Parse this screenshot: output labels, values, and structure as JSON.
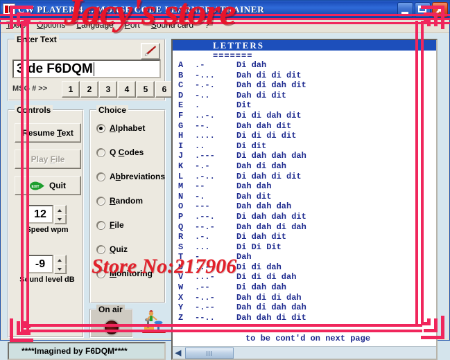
{
  "window": {
    "title": "CW PLAYER 4 ... MORSE CODE LEARNER / TRAINER",
    "icon": "cw-player-icon",
    "buttons": {
      "minimize": "minimize-button",
      "maximize": "maximize-button",
      "close": "close-button"
    }
  },
  "menu": [
    {
      "label": "Tools",
      "accel": "T"
    },
    {
      "label": "Options",
      "accel": "O"
    },
    {
      "label": "Language",
      "accel": "L"
    },
    {
      "label": "Port",
      "accel": "P"
    },
    {
      "label": "Sound card",
      "accel": "S"
    },
    {
      "label": "?",
      "accel": ""
    }
  ],
  "enter_text": {
    "legend": "Enter Text",
    "eraser_icon": "eraser-icon",
    "input_value": "3 de F6DQM",
    "input_placeholder": "",
    "msg_label": "MSG # >>",
    "msg_buttons": [
      "1",
      "2",
      "3",
      "4",
      "5",
      "6"
    ]
  },
  "controls": {
    "legend": "Controls",
    "resume_label": "Resume Text",
    "resume_accel": "T",
    "playfile_label": "Play File",
    "playfile_accel": "F",
    "playfile_enabled": false,
    "quit_label": "Quit",
    "quit_icon": "exit-door-icon",
    "speed_value": "12",
    "speed_label": "Speed   wpm",
    "level_value": "-9",
    "level_label": "Sound level dB"
  },
  "choice": {
    "legend": "Choice",
    "options": [
      {
        "label": "Alphabet",
        "accel": "A",
        "selected": true
      },
      {
        "label": "Q Codes",
        "accel": "C",
        "selected": false
      },
      {
        "label": "Abbreviations",
        "accel": "b",
        "selected": false
      },
      {
        "label": "Random",
        "accel": "R",
        "selected": false
      },
      {
        "label": "File",
        "accel": "F",
        "selected": false
      },
      {
        "label": "Quiz",
        "accel": "Q",
        "selected": false
      },
      {
        "label": "Monitoring",
        "accel": "M",
        "selected": false
      }
    ]
  },
  "on_air": {
    "legend": "On air",
    "led_state": "off",
    "led_color": "#5a1010",
    "telegraph_icon": "telegraph-operator-icon"
  },
  "statusbar": {
    "text": "****Imagined by F6DQM****"
  },
  "letters_pane": {
    "header": "LETTERS",
    "separator": "=======",
    "footer": "to be cont'd on next page",
    "rows": [
      {
        "char": "A",
        "code": ".-",
        "sound": "Di dah"
      },
      {
        "char": "B",
        "code": "-...",
        "sound": "Dah di di dit"
      },
      {
        "char": "C",
        "code": "-.-.",
        "sound": "Dah di dah dit"
      },
      {
        "char": "D",
        "code": "-..",
        "sound": "Dah di dit"
      },
      {
        "char": "E",
        "code": ".",
        "sound": "Dit"
      },
      {
        "char": "F",
        "code": "..-.",
        "sound": "Di di dah dit"
      },
      {
        "char": "G",
        "code": "--.",
        "sound": "Dah dah dit"
      },
      {
        "char": "H",
        "code": "....",
        "sound": "Di di di dit"
      },
      {
        "char": "I",
        "code": "..",
        "sound": "Di dit"
      },
      {
        "char": "J",
        "code": ".---",
        "sound": "Di dah dah dah"
      },
      {
        "char": "K",
        "code": "-.-",
        "sound": "Dah di dah"
      },
      {
        "char": "L",
        "code": ".-..",
        "sound": "Di dah di dit"
      },
      {
        "char": "M",
        "code": "--",
        "sound": "Dah dah"
      },
      {
        "char": "N",
        "code": "-.",
        "sound": "Dah dit"
      },
      {
        "char": "O",
        "code": "---",
        "sound": "Dah dah dah"
      },
      {
        "char": "P",
        "code": ".--.",
        "sound": "Di dah dah dit"
      },
      {
        "char": "Q",
        "code": "--.-",
        "sound": "Dah dah di dah"
      },
      {
        "char": "R",
        "code": ".-.",
        "sound": "Di dah dit"
      },
      {
        "char": "S",
        "code": "...",
        "sound": "Di Di Dit"
      },
      {
        "char": "T",
        "code": "-",
        "sound": "Dah"
      },
      {
        "char": "U",
        "code": "..-",
        "sound": "Di di dah"
      },
      {
        "char": "V",
        "code": "...-",
        "sound": "Di di di dah"
      },
      {
        "char": "W",
        "code": ".--",
        "sound": "Di dah dah"
      },
      {
        "char": "X",
        "code": "-..-",
        "sound": "Dah di di dah"
      },
      {
        "char": "Y",
        "code": "-.--",
        "sound": "Dah di dah dah"
      },
      {
        "char": "Z",
        "code": "--..",
        "sound": "Dah dah di dit"
      }
    ],
    "hscroll": {
      "left_arrow": "scroll-left-arrow",
      "thumb": "scroll-thumb"
    }
  },
  "watermarks": {
    "store_text": "Jacy's store",
    "store_no_text": "Store No:217906",
    "color": "#e8152a",
    "frame_color": "#f0265c"
  }
}
